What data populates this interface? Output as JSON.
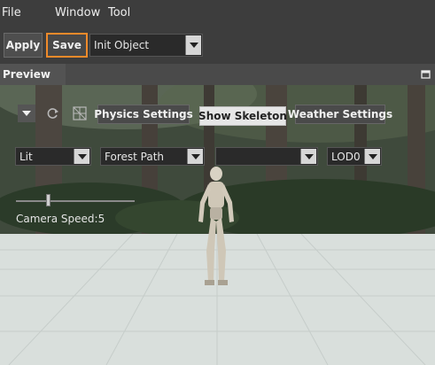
{
  "menu": {
    "file": "File",
    "window": "Window",
    "tool": "Tool"
  },
  "toolbar": {
    "apply_label": "Apply",
    "save_label": "Save",
    "object_select": "Init Object"
  },
  "preview": {
    "tab_label": "Preview",
    "physics_settings": "Physics Settings",
    "show_skeleton": "Show Skeleton",
    "weather_settings": "Weather Settings",
    "render_mode": "Lit",
    "scene": "Forest Path",
    "extra_select": "",
    "lod": "LOD0",
    "camera_speed_label": "Camera Speed:5",
    "camera_speed_level": 0.27
  },
  "colors": {
    "accent": "#f08a2a",
    "ground": "#d9dfdc",
    "panel": "#3d3d3d"
  }
}
